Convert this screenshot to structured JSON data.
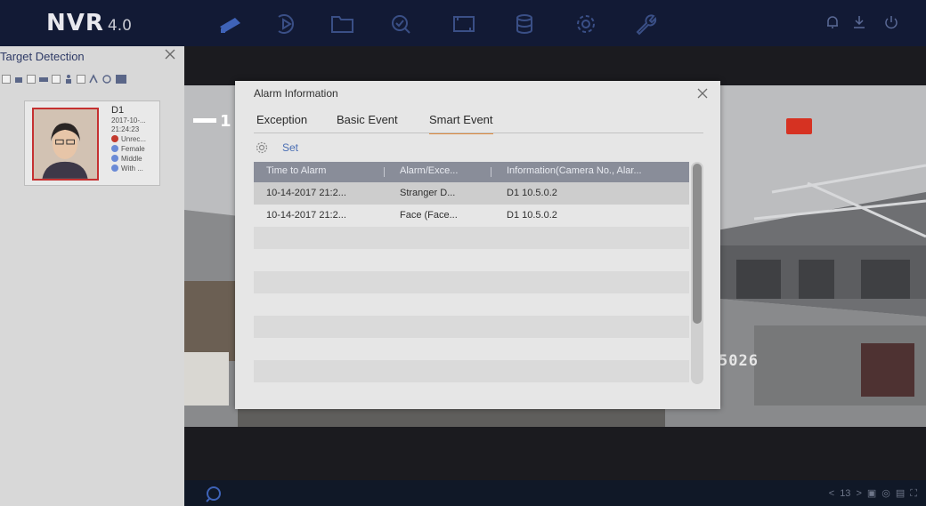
{
  "app": {
    "logo": "NVR",
    "version": "4.0"
  },
  "nav_icons": [
    "live-view-icon",
    "playback-icon",
    "file-management-icon",
    "smart-analysis-icon",
    "configuration-icon",
    "storage-icon",
    "system-settings-icon",
    "maintenance-icon"
  ],
  "top_right_icons": [
    "alarm-bell-icon",
    "download-icon",
    "power-icon"
  ],
  "target_detection": {
    "title": "Target Detection",
    "filters": [
      "face-filter-icon",
      "vehicle-filter-icon",
      "human-body-filter-icon",
      "rule-filter-icon",
      "smart-detection-filter-icon"
    ],
    "card": {
      "camera": "D1",
      "date": "2017-10-...",
      "time": "21:24:23",
      "attributes": [
        "Unrec...",
        "Female",
        "Middle",
        "With ..."
      ]
    }
  },
  "live": {
    "channel": "1",
    "overlay_text": "5026"
  },
  "alarm_dialog": {
    "title": "Alarm Information",
    "tabs": [
      "Exception",
      "Basic Event",
      "Smart Event"
    ],
    "active_tab": "Smart Event",
    "set_label": "Set",
    "columns": [
      "Time to Alarm",
      "Alarm/Exce...",
      "Information(Camera No., Alar..."
    ],
    "rows": [
      {
        "time": "10-14-2017 21:2...",
        "type": "Stranger D...",
        "info": "D1  10.5.0.2"
      },
      {
        "time": "10-14-2017 21:2...",
        "type": "Face (Face...",
        "info": "D1  10.5.0.2"
      }
    ]
  },
  "bottom_bar": {
    "page_indicator": "13"
  },
  "colors": {
    "topbar": "#121a35",
    "accent_tab": "#e08a3c",
    "link": "#4a6eb3",
    "alert": "#d63222"
  }
}
